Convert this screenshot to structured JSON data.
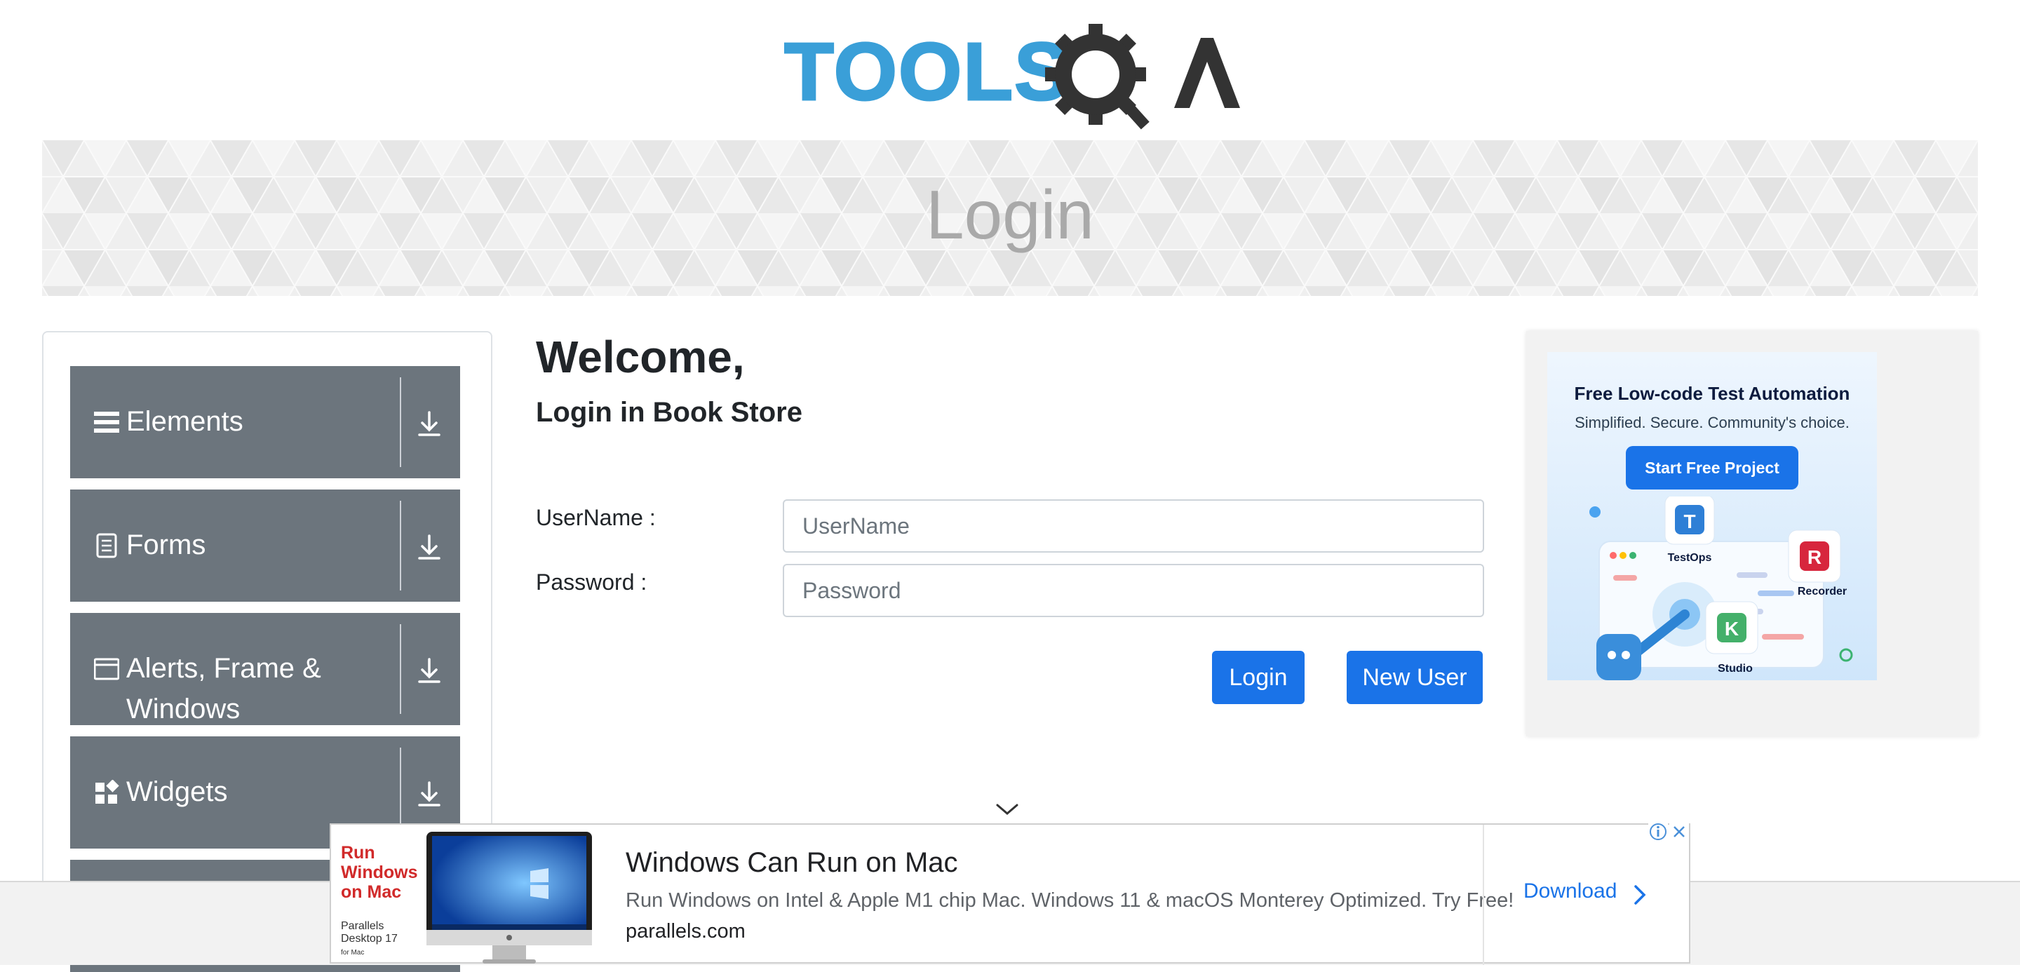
{
  "header": {
    "logo": {
      "text_part": "TOOLS",
      "icon_part": "QA",
      "icon": "tools-qa-gear-logo",
      "colors": {
        "blue": "#3a9fd8",
        "dark": "#333333"
      }
    }
  },
  "banner": {
    "title": "Login"
  },
  "sidebar": {
    "groups": [
      {
        "label": "Elements",
        "icon": "menu-bars-icon"
      },
      {
        "label": "Forms",
        "icon": "document-icon"
      },
      {
        "label": "Alerts, Frame & Windows",
        "icon": "window-icon"
      },
      {
        "label": "Widgets",
        "icon": "widgets-icon"
      },
      {
        "label": "",
        "icon": ""
      }
    ],
    "expand_icon": "download-arrow-icon"
  },
  "login": {
    "welcome": "Welcome,",
    "subtitle": "Login in Book Store",
    "username_label": "UserName :",
    "username_placeholder": "UserName",
    "password_label": "Password :",
    "password_placeholder": "Password",
    "login_button": "Login",
    "new_user_button": "New User"
  },
  "right_ad": {
    "title": "Free Low-code Test Automation",
    "subtitle": "Simplified. Secure. Community's choice.",
    "button": "Start Free Project",
    "apps": [
      {
        "name": "TestOps",
        "letter": "T"
      },
      {
        "name": "Recorder",
        "letter": "R"
      },
      {
        "name": "Studio",
        "letter": "K"
      }
    ]
  },
  "bottom_ad": {
    "brand": "Run Windows on Mac",
    "product": "Parallels Desktop 17",
    "product_note": "for Mac",
    "headline": "Windows Can Run on Mac",
    "description": "Run Windows on Intel & Apple M1 chip Mac. Windows 11 & macOS Monterey Optimized. Try Free!",
    "domain": "parallels.com",
    "cta": "Download"
  },
  "colors": {
    "primary": "#1a73e8",
    "sidebar_header": "#6c757d",
    "banner_text": "#a9a9a9"
  }
}
